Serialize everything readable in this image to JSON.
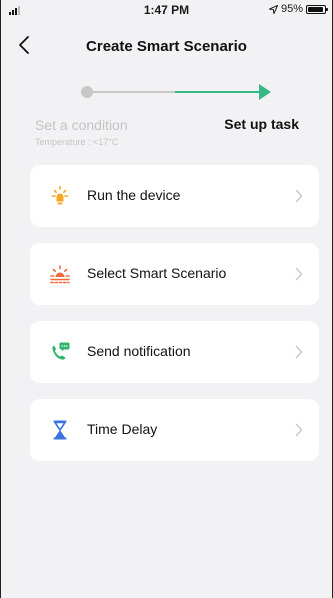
{
  "status_bar": {
    "time": "1:47 PM",
    "battery_text": "95%",
    "battery_level_percent": 95
  },
  "nav": {
    "title": "Create Smart Scenario"
  },
  "steps": {
    "condition_label": "Set a condition",
    "condition_detail": "Temperature : <17°C",
    "task_label": "Set up task",
    "inactive_color": "#c7c7c7",
    "active_color": "#35b786"
  },
  "tasks": [
    {
      "label": "Run the device",
      "icon": "sun-device-icon",
      "color": "#f5a623"
    },
    {
      "label": "Select Smart Scenario",
      "icon": "sunrise-icon",
      "color": "#ef6a3a"
    },
    {
      "label": "Send notification",
      "icon": "phone-message-icon",
      "color": "#2fb46c"
    },
    {
      "label": "Time Delay",
      "icon": "hourglass-icon",
      "color": "#3b74e0"
    }
  ]
}
